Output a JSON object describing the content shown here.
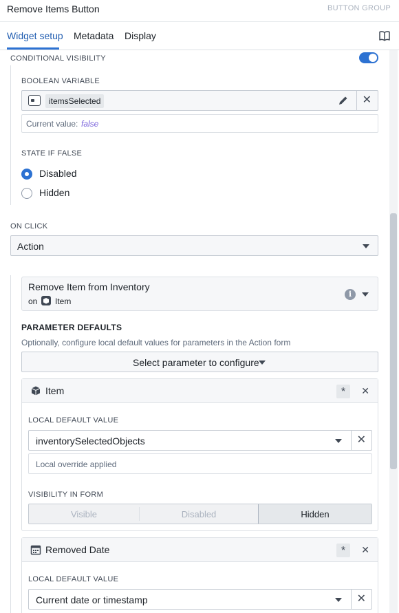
{
  "header": {
    "title": "Remove Items Button",
    "type_label": "BUTTON GROUP"
  },
  "tabs": [
    {
      "label": "Widget setup",
      "active": true
    },
    {
      "label": "Metadata",
      "active": false
    },
    {
      "label": "Display",
      "active": false
    }
  ],
  "conditional_visibility": {
    "label": "CONDITIONAL VISIBILITY",
    "enabled": true,
    "boolean_variable": {
      "label": "BOOLEAN VARIABLE",
      "variable_name": "itemsSelected",
      "current_value_label": "Current value:",
      "current_value": "false"
    },
    "state_if_false": {
      "label": "STATE IF FALSE",
      "options": [
        "Disabled",
        "Hidden"
      ],
      "selected": "Disabled"
    }
  },
  "on_click": {
    "label": "ON CLICK",
    "value": "Action",
    "action": {
      "name": "Remove Item from Inventory",
      "on_label": "on",
      "object_type": "Item"
    }
  },
  "parameter_defaults": {
    "title": "PARAMETER DEFAULTS",
    "description": "Optionally, configure local default values for parameters in the Action form",
    "select_button": "Select parameter to configure",
    "parameters": [
      {
        "name": "Item",
        "icon": "cube-icon",
        "default_label": "LOCAL DEFAULT VALUE",
        "default_value": "inventorySelectedObjects",
        "override_note": "Local override applied",
        "visibility_label": "VISIBILITY IN FORM",
        "visibility_options": [
          "Visible",
          "Disabled",
          "Hidden"
        ],
        "visibility_selected": "Hidden"
      },
      {
        "name": "Removed Date",
        "icon": "calendar-icon",
        "default_label": "LOCAL DEFAULT VALUE",
        "default_value": "Current date or timestamp"
      }
    ]
  },
  "colors": {
    "accent": "#2d72d2",
    "text": "#1c2127",
    "muted": "#5f6b7c",
    "border": "#c5cbd3"
  }
}
